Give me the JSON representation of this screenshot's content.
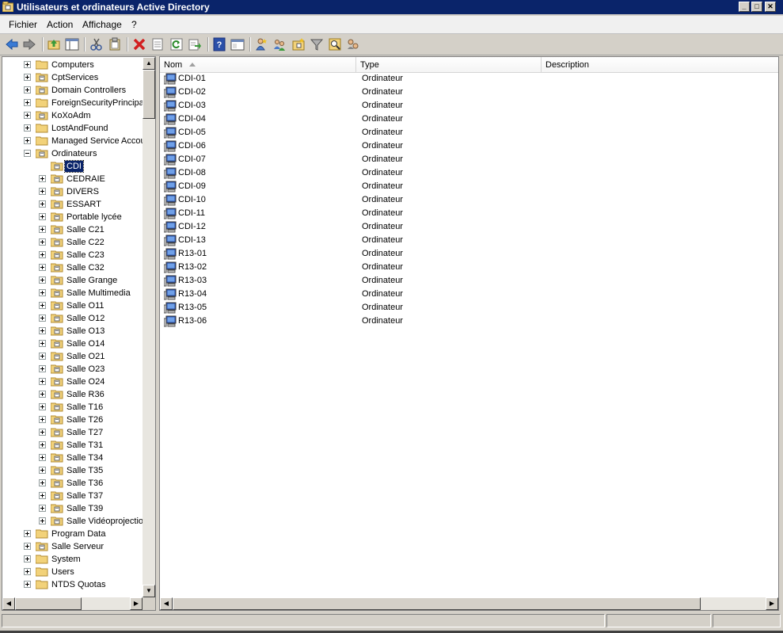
{
  "window": {
    "title": "Utilisateurs et ordinateurs Active Directory"
  },
  "menu": [
    "Fichier",
    "Action",
    "Affichage",
    "?"
  ],
  "toolbar_icons": [
    "back-arrow-icon",
    "forward-arrow-icon",
    "up-folder-icon",
    "show-hide-tree-icon",
    "cut-icon",
    "copy-icon",
    "delete-icon",
    "properties-icon",
    "refresh-icon",
    "export-list-icon",
    "help-icon",
    "console-tree-icon",
    "new-user-icon",
    "new-group-icon",
    "new-ou-icon",
    "filter-icon",
    "find-icon",
    "add-to-group-icon"
  ],
  "tree": [
    {
      "label": "Computers",
      "level": 1,
      "expander": "plus",
      "icon": "folder"
    },
    {
      "label": "CptServices",
      "level": 1,
      "expander": "plus",
      "icon": "ou"
    },
    {
      "label": "Domain Controllers",
      "level": 1,
      "expander": "plus",
      "icon": "ou"
    },
    {
      "label": "ForeignSecurityPrincipal",
      "level": 1,
      "expander": "plus",
      "icon": "folder"
    },
    {
      "label": "KoXoAdm",
      "level": 1,
      "expander": "plus",
      "icon": "ou"
    },
    {
      "label": "LostAndFound",
      "level": 1,
      "expander": "plus",
      "icon": "folder"
    },
    {
      "label": "Managed Service Accou",
      "level": 1,
      "expander": "plus",
      "icon": "folder"
    },
    {
      "label": "Ordinateurs",
      "level": 1,
      "expander": "minus",
      "icon": "ou"
    },
    {
      "label": "CDI",
      "level": 2,
      "expander": "none",
      "icon": "ou",
      "selected": true
    },
    {
      "label": "CEDRAIE",
      "level": 2,
      "expander": "plus",
      "icon": "ou"
    },
    {
      "label": "DIVERS",
      "level": 2,
      "expander": "plus",
      "icon": "ou"
    },
    {
      "label": "ESSART",
      "level": 2,
      "expander": "plus",
      "icon": "ou"
    },
    {
      "label": "Portable lycée",
      "level": 2,
      "expander": "plus",
      "icon": "ou"
    },
    {
      "label": "Salle C21",
      "level": 2,
      "expander": "plus",
      "icon": "ou"
    },
    {
      "label": "Salle C22",
      "level": 2,
      "expander": "plus",
      "icon": "ou"
    },
    {
      "label": "Salle C23",
      "level": 2,
      "expander": "plus",
      "icon": "ou"
    },
    {
      "label": "Salle C32",
      "level": 2,
      "expander": "plus",
      "icon": "ou"
    },
    {
      "label": "Salle Grange",
      "level": 2,
      "expander": "plus",
      "icon": "ou"
    },
    {
      "label": "Salle Multimedia",
      "level": 2,
      "expander": "plus",
      "icon": "ou"
    },
    {
      "label": "Salle O11",
      "level": 2,
      "expander": "plus",
      "icon": "ou"
    },
    {
      "label": "Salle O12",
      "level": 2,
      "expander": "plus",
      "icon": "ou"
    },
    {
      "label": "Salle O13",
      "level": 2,
      "expander": "plus",
      "icon": "ou"
    },
    {
      "label": "Salle O14",
      "level": 2,
      "expander": "plus",
      "icon": "ou"
    },
    {
      "label": "Salle O21",
      "level": 2,
      "expander": "plus",
      "icon": "ou"
    },
    {
      "label": "Salle O23",
      "level": 2,
      "expander": "plus",
      "icon": "ou"
    },
    {
      "label": "Salle O24",
      "level": 2,
      "expander": "plus",
      "icon": "ou"
    },
    {
      "label": "Salle R36",
      "level": 2,
      "expander": "plus",
      "icon": "ou"
    },
    {
      "label": "Salle T16",
      "level": 2,
      "expander": "plus",
      "icon": "ou"
    },
    {
      "label": "Salle T26",
      "level": 2,
      "expander": "plus",
      "icon": "ou"
    },
    {
      "label": "Salle T27",
      "level": 2,
      "expander": "plus",
      "icon": "ou"
    },
    {
      "label": "Salle T31",
      "level": 2,
      "expander": "plus",
      "icon": "ou"
    },
    {
      "label": "Salle T34",
      "level": 2,
      "expander": "plus",
      "icon": "ou"
    },
    {
      "label": "Salle T35",
      "level": 2,
      "expander": "plus",
      "icon": "ou"
    },
    {
      "label": "Salle T36",
      "level": 2,
      "expander": "plus",
      "icon": "ou"
    },
    {
      "label": "Salle T37",
      "level": 2,
      "expander": "plus",
      "icon": "ou"
    },
    {
      "label": "Salle T39",
      "level": 2,
      "expander": "plus",
      "icon": "ou"
    },
    {
      "label": "Salle Vidéoprojection",
      "level": 2,
      "expander": "plus",
      "icon": "ou"
    },
    {
      "label": "Program Data",
      "level": 1,
      "expander": "plus",
      "icon": "folder"
    },
    {
      "label": "Salle Serveur",
      "level": 1,
      "expander": "plus",
      "icon": "ou"
    },
    {
      "label": "System",
      "level": 1,
      "expander": "plus",
      "icon": "folder"
    },
    {
      "label": "Users",
      "level": 1,
      "expander": "plus",
      "icon": "folder"
    },
    {
      "label": "NTDS Quotas",
      "level": 1,
      "expander": "plus",
      "icon": "folder"
    }
  ],
  "list": {
    "columns": [
      "Nom",
      "Type",
      "Description"
    ],
    "sort_indicator": "sort-ascending-icon",
    "rows": [
      {
        "name": "CDI-01",
        "type": "Ordinateur"
      },
      {
        "name": "CDI-02",
        "type": "Ordinateur"
      },
      {
        "name": "CDI-03",
        "type": "Ordinateur"
      },
      {
        "name": "CDI-04",
        "type": "Ordinateur"
      },
      {
        "name": "CDI-05",
        "type": "Ordinateur"
      },
      {
        "name": "CDI-06",
        "type": "Ordinateur"
      },
      {
        "name": "CDI-07",
        "type": "Ordinateur"
      },
      {
        "name": "CDI-08",
        "type": "Ordinateur"
      },
      {
        "name": "CDI-09",
        "type": "Ordinateur"
      },
      {
        "name": "CDI-10",
        "type": "Ordinateur"
      },
      {
        "name": "CDI-11",
        "type": "Ordinateur"
      },
      {
        "name": "CDI-12",
        "type": "Ordinateur"
      },
      {
        "name": "CDI-13",
        "type": "Ordinateur"
      },
      {
        "name": "R13-01",
        "type": "Ordinateur"
      },
      {
        "name": "R13-02",
        "type": "Ordinateur"
      },
      {
        "name": "R13-03",
        "type": "Ordinateur"
      },
      {
        "name": "R13-04",
        "type": "Ordinateur"
      },
      {
        "name": "R13-05",
        "type": "Ordinateur"
      },
      {
        "name": "R13-06",
        "type": "Ordinateur"
      }
    ]
  },
  "colors": {
    "titlebar": "#0a246a",
    "selection": "#0a246a",
    "folder": "#f2d27a"
  }
}
